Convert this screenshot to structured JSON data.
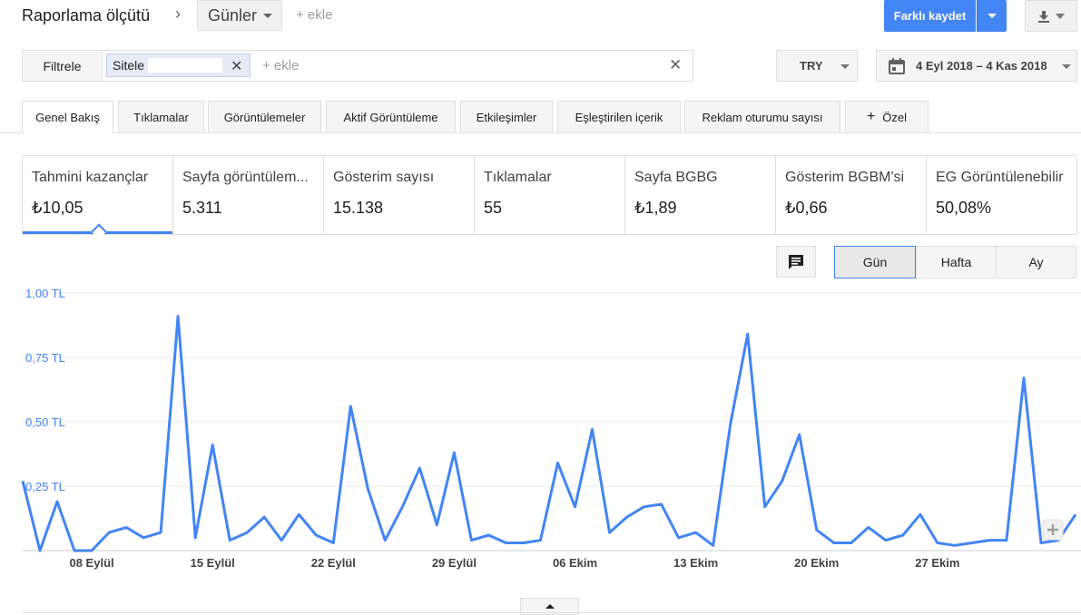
{
  "header": {
    "title": "Raporlama ölçütü",
    "dimension": "Günler",
    "add_dimension": "+ ekle",
    "save_label": "Farklı kaydet"
  },
  "filter": {
    "button_label": "Filtrele",
    "chip_label": "Sitele",
    "add_label": "+ ekle"
  },
  "currency": "TRY",
  "date_range": "4 Eyl 2018 – 4 Kas 2018",
  "tabs": [
    {
      "label": "Genel Bakış",
      "active": true
    },
    {
      "label": "Tıklamalar"
    },
    {
      "label": "Görüntülemeler"
    },
    {
      "label": "Aktif Görüntüleme"
    },
    {
      "label": "Etkileşimler"
    },
    {
      "label": "Eşleştirilen içerik"
    },
    {
      "label": "Reklam oturumu sayısı"
    },
    {
      "label": "Özel",
      "icon": "plus-icon"
    }
  ],
  "kpis": [
    {
      "label": "Tahmini kazançlar",
      "value": "₺10,05",
      "selected": true
    },
    {
      "label": "Sayfa görüntülem...",
      "value": "5.311"
    },
    {
      "label": "Gösterim sayısı",
      "value": "15.138"
    },
    {
      "label": "Tıklamalar",
      "value": "55"
    },
    {
      "label": "Sayfa BGBG",
      "value": "₺1,89"
    },
    {
      "label": "Gösterim BGBM'si",
      "value": "₺0,66"
    },
    {
      "label": "EG Görüntülenebilir",
      "value": "50,08%"
    }
  ],
  "granularity": [
    {
      "label": "Gün",
      "active": true
    },
    {
      "label": "Hafta"
    },
    {
      "label": "Ay"
    }
  ],
  "colors": {
    "accent": "#4285f4",
    "axis_label": "#4285f4"
  },
  "chart_data": {
    "type": "line",
    "title": "",
    "xlabel": "",
    "ylabel": "",
    "ylim": [
      0,
      1
    ],
    "yticks": [
      "1,00 TL",
      "0,75 TL",
      "0,50 TL",
      "0,25 TL"
    ],
    "ytick_values": [
      1.0,
      0.75,
      0.5,
      0.25
    ],
    "xticks": [
      "08 Eylül",
      "15 Eylül",
      "22 Eylül",
      "29 Eylül",
      "06 Ekim",
      "13 Ekim",
      "20 Ekim",
      "27 Ekim"
    ],
    "xtick_days": [
      4,
      11,
      18,
      25,
      32,
      39,
      46,
      53
    ],
    "grid": true,
    "series": [
      {
        "values": [
          0.27,
          0.0,
          0.19,
          0.0,
          0.0,
          0.07,
          0.09,
          0.05,
          0.07,
          0.91,
          0.05,
          0.41,
          0.04,
          0.07,
          0.13,
          0.04,
          0.14,
          0.06,
          0.03,
          0.56,
          0.24,
          0.04,
          0.17,
          0.32,
          0.1,
          0.38,
          0.04,
          0.06,
          0.03,
          0.03,
          0.04,
          0.34,
          0.17,
          0.47,
          0.07,
          0.13,
          0.17,
          0.18,
          0.05,
          0.07,
          0.02,
          0.49,
          0.84,
          0.17,
          0.27,
          0.45,
          0.08,
          0.03,
          0.03,
          0.09,
          0.04,
          0.06,
          0.14,
          0.03,
          0.02,
          0.03,
          0.04,
          0.04,
          0.67,
          0.03,
          0.04,
          0.14
        ]
      }
    ]
  }
}
